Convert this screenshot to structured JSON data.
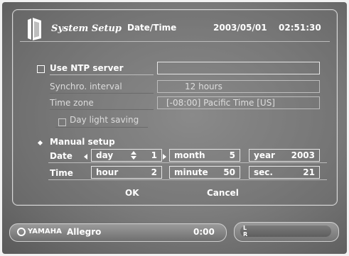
{
  "header": {
    "brand": "System Setup",
    "page": "Date/Time",
    "date": "2003/05/01",
    "time": "02:51:30"
  },
  "ntp": {
    "use_label": "Use NTP server",
    "server_value": "",
    "synchro_label": "Synchro. interval",
    "synchro_value": "12   hours",
    "timezone_label": "Time zone",
    "timezone_value": "[-08:00] Pacific Time [US]",
    "daylight_label": "Day light saving"
  },
  "manual": {
    "label": "Manual setup",
    "date_label": "Date",
    "time_label": "Time",
    "day_key": "day",
    "day_value": "1",
    "month_key": "month",
    "month_value": "5",
    "year_key": "year",
    "year_value": "2003",
    "hour_key": "hour",
    "hour_value": "2",
    "minute_key": "minute",
    "minute_value": "50",
    "sec_key": "sec.",
    "sec_value": "21"
  },
  "actions": {
    "ok": "OK",
    "cancel": "Cancel"
  },
  "player": {
    "brand": "YAMAHA",
    "title": "Allegro",
    "elapsed": "0:00",
    "meter_l": "L",
    "meter_r": "R"
  },
  "colors": {
    "background": "#808080",
    "text": "#ffffff"
  }
}
